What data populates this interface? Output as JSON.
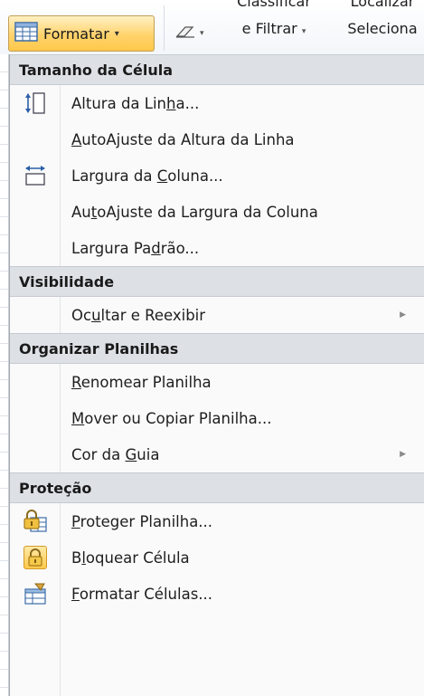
{
  "ribbon": {
    "format_button": {
      "label": "Formatar",
      "icon": "format-cells-icon",
      "dropdown": "▾"
    },
    "clear_button": {
      "icon": "eraser-icon",
      "dropdown": "▾"
    },
    "sort_filter": {
      "line1": "Classificar",
      "line2": "e Filtrar",
      "dropdown": "▾"
    },
    "find_select": {
      "line1": "Localizar",
      "line2": "Seleciona"
    }
  },
  "menu": {
    "sections": [
      {
        "header": "Tamanho da Célula",
        "items": [
          {
            "pre": "Altura da Lin",
            "mn": "h",
            "post": "a...",
            "icon": "row-height-icon"
          },
          {
            "pre": "",
            "mn": "A",
            "post": "utoAjuste da Altura da Linha",
            "icon": ""
          },
          {
            "pre": "Largura da ",
            "mn": "C",
            "post": "oluna...",
            "icon": "column-width-icon"
          },
          {
            "pre": "Au",
            "mn": "t",
            "post": "oAjuste da Largura da Coluna",
            "icon": ""
          },
          {
            "pre": "Largura Pa",
            "mn": "d",
            "post": "rão...",
            "icon": ""
          }
        ]
      },
      {
        "header": "Visibilidade",
        "items": [
          {
            "pre": "Oc",
            "mn": "u",
            "post": "ltar e Reexibir",
            "icon": "",
            "submenu": "▶"
          }
        ]
      },
      {
        "header": "Organizar Planilhas",
        "items": [
          {
            "pre": "",
            "mn": "R",
            "post": "enomear Planilha",
            "icon": ""
          },
          {
            "pre": "",
            "mn": "M",
            "post": "over ou Copiar Planilha...",
            "icon": ""
          },
          {
            "pre": "Cor da ",
            "mn": "G",
            "post": "uia",
            "icon": "",
            "submenu": "▶"
          }
        ]
      },
      {
        "header": "Proteção",
        "items": [
          {
            "pre": "",
            "mn": "P",
            "post": "roteger Planilha...",
            "icon": "protect-sheet-icon"
          },
          {
            "pre": "B",
            "mn": "l",
            "post": "oquear Célula",
            "icon": "lock-cell-icon"
          },
          {
            "pre": "",
            "mn": "F",
            "post": "ormatar Células...",
            "icon": "format-cells-dialog-icon"
          }
        ]
      }
    ]
  }
}
